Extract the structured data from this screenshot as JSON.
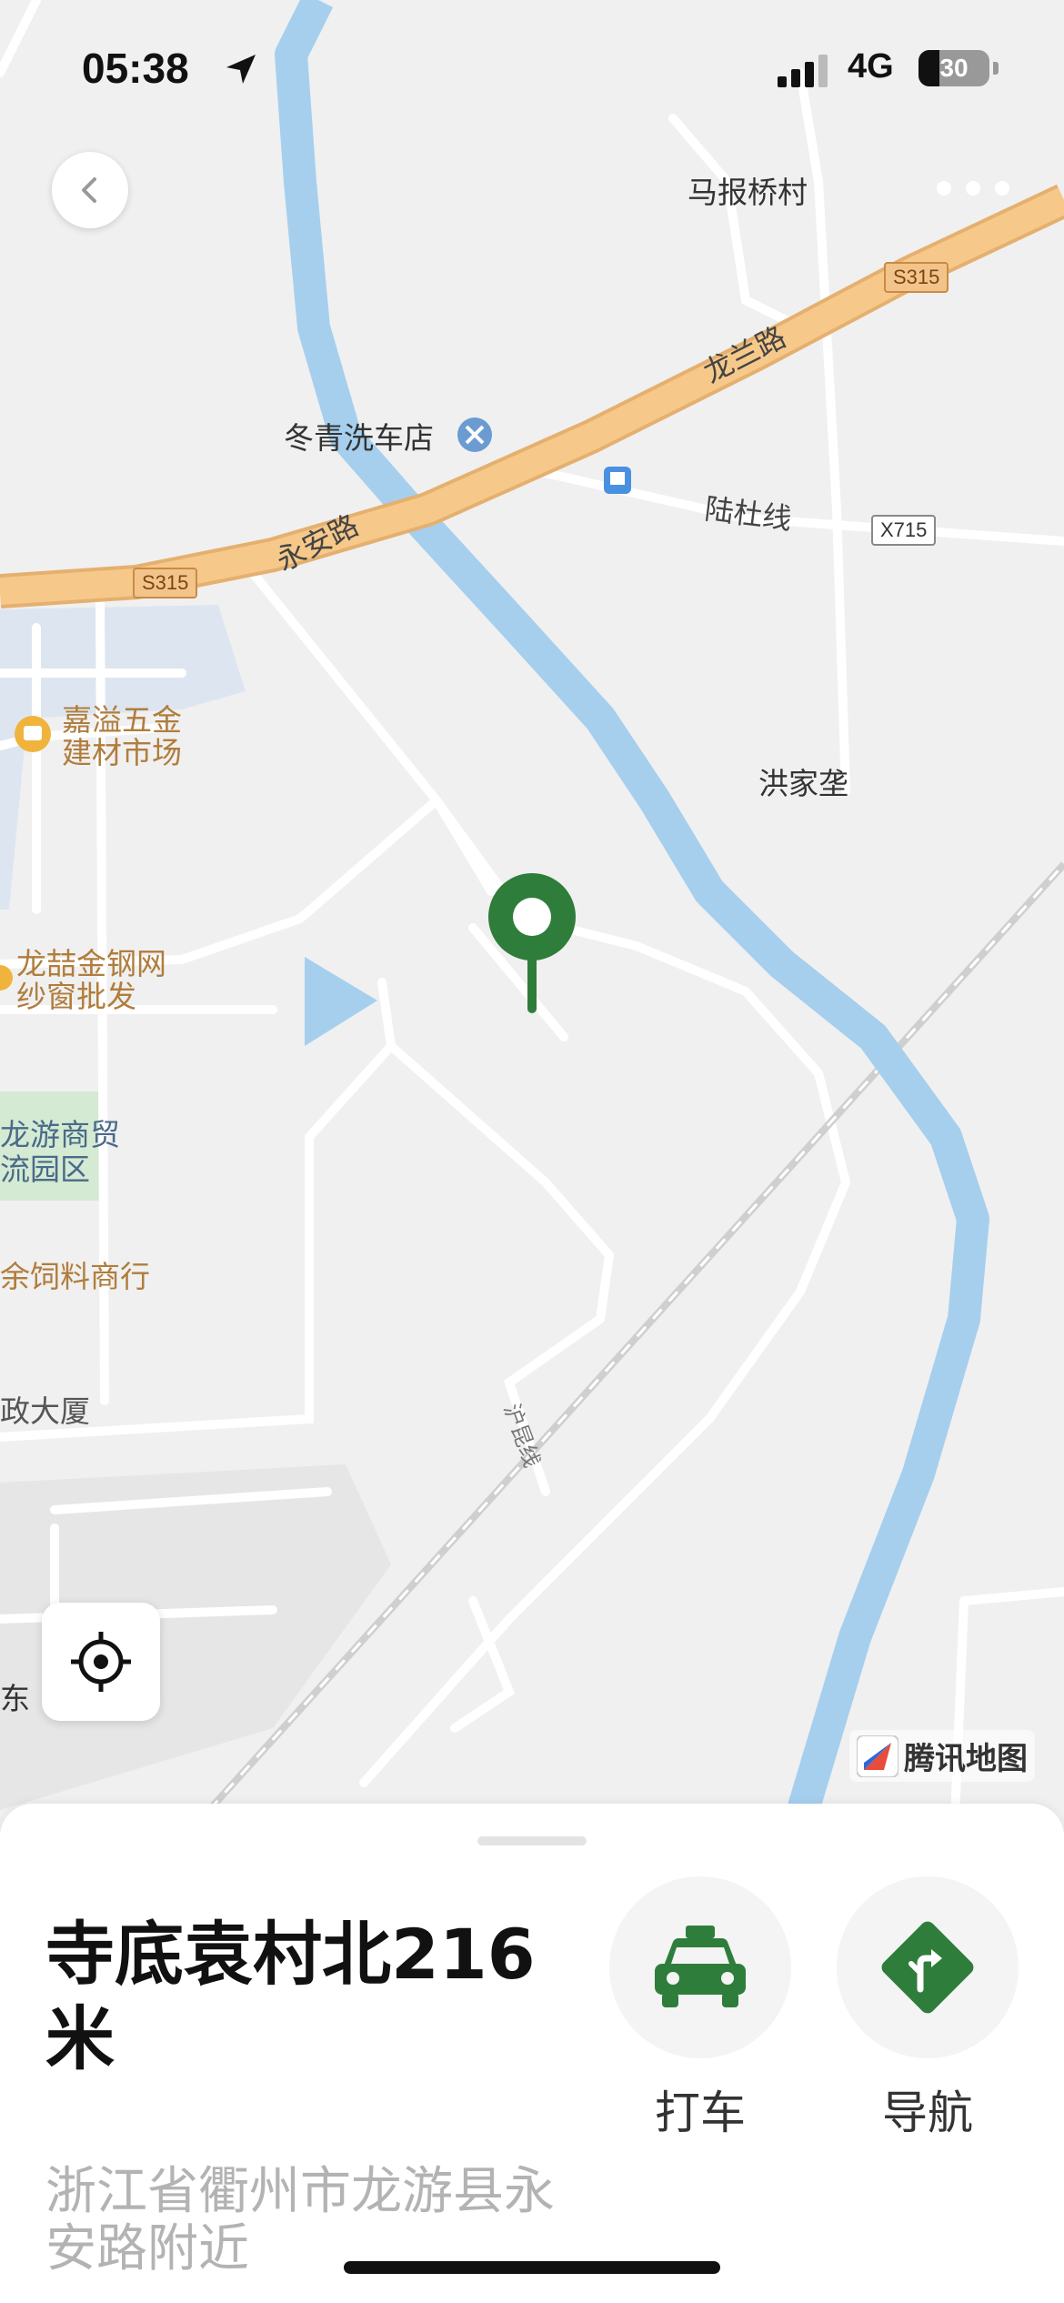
{
  "status_bar": {
    "time": "05:38",
    "network": "4G",
    "battery": "30",
    "battery_level": 0.3
  },
  "map": {
    "labels": {
      "village_mabao": "马报桥村",
      "road_longlan": "龙兰路",
      "road_yongan": "永安路",
      "carwash": "冬青洗车店",
      "road_ludu": "陆杜线",
      "village_hongjia": "洪家垄",
      "poi_jiayi_1": "嘉溢五金",
      "poi_jiayi_2": "建材市场",
      "poi_longzhe_1": "龙喆金钢网",
      "poi_longzhe_2": "纱窗批发",
      "park_1": "龙游商贸",
      "park_2": "流园区",
      "poi_feed": "余饲料商行",
      "poi_building": "政大厦",
      "rail": "沪昆线",
      "east_partial": "东"
    },
    "shields": {
      "s315_a": "S315",
      "s315_b": "S315",
      "x715": "X715"
    },
    "logo_text": "腾讯地图"
  },
  "place": {
    "name": "寺底袁村北216米",
    "address": "浙江省衢州市龙游县永安路附近"
  },
  "actions": {
    "taxi_label": "打车",
    "navigate_label": "导航"
  },
  "colors": {
    "accent_green": "#2f7d3b",
    "river_blue": "#a6cfee",
    "highway_orange": "#f6c98a"
  }
}
